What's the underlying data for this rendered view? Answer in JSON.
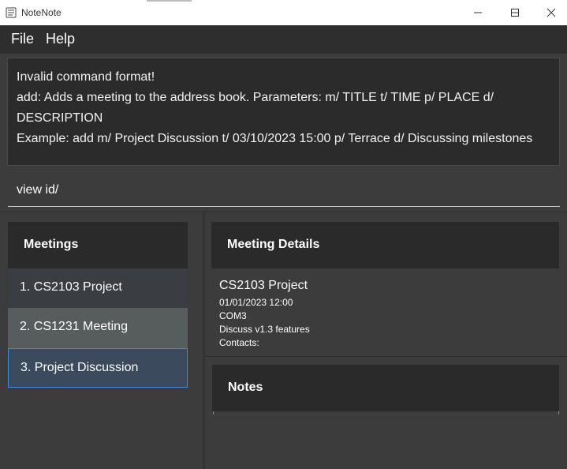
{
  "window": {
    "title": "NoteNote"
  },
  "menu": {
    "items": [
      "File",
      "Help"
    ]
  },
  "result": {
    "lines": [
      "Invalid command format!",
      "add: Adds a meeting to the address book. Parameters: m/ TITLE t/ TIME p/ PLACE d/",
      "DESCRIPTION",
      "Example: add m/ Project Discussion t/ 03/10/2023 15:00 p/ Terrace d/ Discussing milestones"
    ]
  },
  "command": {
    "value": "view id/"
  },
  "meetings": {
    "title": "Meetings",
    "items": [
      {
        "label": "1.  CS2103 Project",
        "state": "normal"
      },
      {
        "label": "2.  CS1231 Meeting",
        "state": "hover"
      },
      {
        "label": "3.  Project Discussion",
        "state": "selected"
      }
    ]
  },
  "details": {
    "title": "Meeting Details",
    "name": "CS2103 Project",
    "time": "01/01/2023 12:00",
    "place": "COM3",
    "description": "Discuss v1.3 features",
    "contacts": "Contacts:"
  },
  "notes": {
    "title": "Notes"
  },
  "colors": {
    "background": "#3c3c3c",
    "panel_header": "#2a2a2a",
    "row_normal": "#3a3d41",
    "row_hover": "#575c5d",
    "row_selected": "#3b4a5c",
    "row_selected_border": "#3b8ed6"
  }
}
